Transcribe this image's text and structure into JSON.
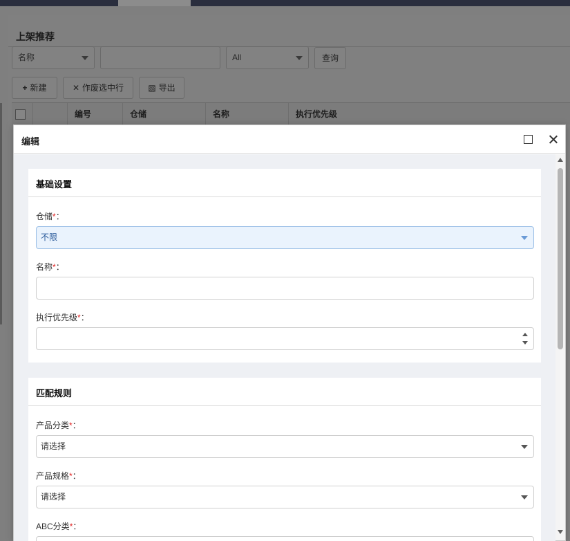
{
  "background": {
    "panel_title": "上架推荐",
    "filter": {
      "field_select": "名称",
      "search_value": "",
      "status_select": "All",
      "query_button": "查询"
    },
    "toolbar": {
      "new_button": "新建",
      "void_button": "作废选中行",
      "export_button": "导出"
    },
    "table_columns": [
      "编号",
      "仓储",
      "名称",
      "执行优先级"
    ]
  },
  "modal": {
    "title": "编辑",
    "sections": [
      {
        "title": "基础设置",
        "fields": [
          {
            "label": "仓储",
            "type": "select",
            "value": "不限"
          },
          {
            "label": "名称",
            "type": "text",
            "value": ""
          },
          {
            "label": "执行优先级",
            "type": "number",
            "value": ""
          }
        ]
      },
      {
        "title": "匹配规则",
        "fields": [
          {
            "label": "产品分类",
            "type": "select",
            "value": "请选择"
          },
          {
            "label": "产品规格",
            "type": "select",
            "value": "请选择"
          },
          {
            "label": "ABC分类",
            "type": "select",
            "value": ""
          }
        ]
      }
    ],
    "required_mark": "*",
    "label_suffix": "："
  },
  "colors": {
    "modal_body_bg": "#eef0f4",
    "focused_field_bg": "#eaf3fd",
    "required_red": "#e02020",
    "topbar_dark": "#2a2e3e"
  }
}
